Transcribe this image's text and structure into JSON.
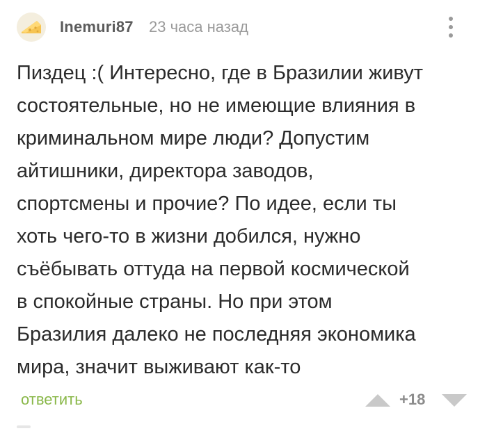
{
  "comment": {
    "author": "Inemuri87",
    "time": "23 часа назад",
    "text": "Пиздец :( Интересно, где в Бразилии живут\nсостоятельные, но не имеющие влияния в\nкриминальном мире люди? Допустим\nайтишники, директора заводов,\nспортсмены и прочие? По идее, если ты\nхоть чего-то в жизни добился, нужно\nсъёбывать оттуда на первой космической\nв спокойные страны. Но при этом\nБразилия далеко не последняя экономика\nмира, значит выживают как-то",
    "reply_label": "ответить",
    "rating": "+18"
  },
  "icons": {
    "avatar": "cheese-avatar-icon",
    "more": "more-vertical-icon",
    "upvote": "upvote-triangle-icon",
    "downvote": "downvote-triangle-icon"
  },
  "colors": {
    "accent_green": "#8ab84a",
    "vote_gray": "#c9c9c9",
    "meta_gray": "#9a9a9a"
  }
}
